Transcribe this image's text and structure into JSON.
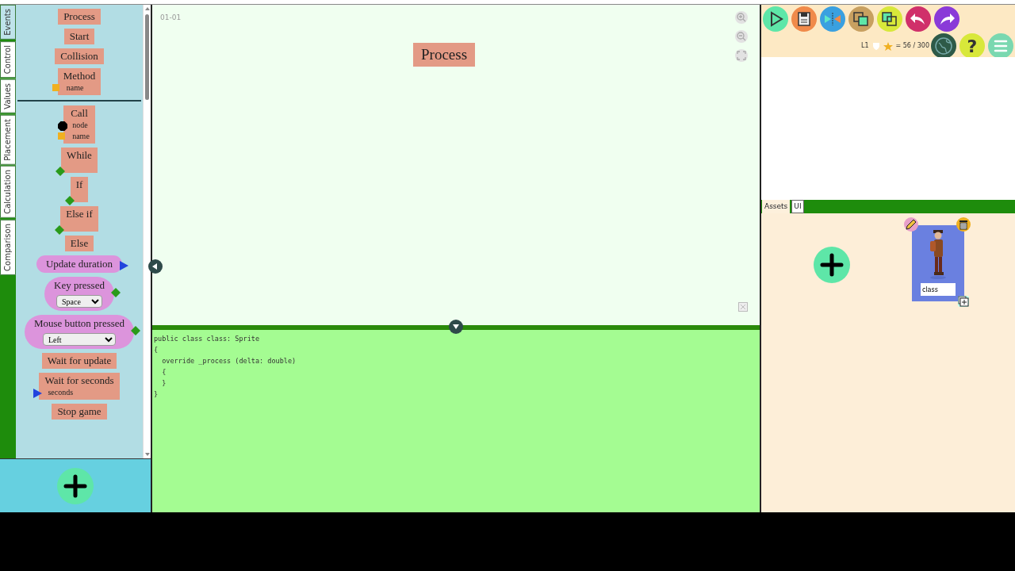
{
  "category_tabs": [
    {
      "label": "Events",
      "selected": true
    },
    {
      "label": "Control",
      "selected": false
    },
    {
      "label": "Values",
      "selected": false
    },
    {
      "label": "Placement",
      "selected": false
    },
    {
      "label": "Calculation",
      "selected": false
    },
    {
      "label": "Comparison",
      "selected": false
    }
  ],
  "palette": {
    "groups": [
      [
        {
          "label": "Process",
          "kind": "action"
        },
        {
          "label": "Start",
          "kind": "action"
        },
        {
          "label": "Collision",
          "kind": "action"
        },
        {
          "label": "Method",
          "kind": "action",
          "ports": [
            {
              "kind": "param",
              "label": "name"
            }
          ]
        }
      ],
      [
        {
          "label": "Call",
          "kind": "action",
          "ports": [
            {
              "kind": "node",
              "label": "node"
            },
            {
              "kind": "param",
              "label": "name"
            }
          ]
        },
        {
          "label": "While",
          "kind": "action",
          "ports": [
            {
              "kind": "condition"
            }
          ]
        },
        {
          "label": "If",
          "kind": "action",
          "ports": [
            {
              "kind": "condition"
            }
          ]
        },
        {
          "label": "Else if",
          "kind": "action",
          "ports": [
            {
              "kind": "condition"
            }
          ]
        },
        {
          "label": "Else",
          "kind": "action"
        },
        {
          "label": "Update duration",
          "kind": "trigger",
          "ports": [
            {
              "kind": "number"
            }
          ]
        },
        {
          "label": "Key pressed",
          "kind": "trigger",
          "ports": [
            {
              "kind": "condition"
            }
          ],
          "select": "Space"
        },
        {
          "label": "Mouse button pressed",
          "kind": "trigger",
          "ports": [
            {
              "kind": "condition"
            }
          ],
          "select": "Left"
        },
        {
          "label": "Wait for update",
          "kind": "action"
        },
        {
          "label": "Wait for seconds",
          "kind": "action",
          "ports": [
            {
              "kind": "number",
              "label": "seconds"
            }
          ]
        },
        {
          "label": "Stop game",
          "kind": "action"
        }
      ]
    ]
  },
  "canvas": {
    "scene_label": "01-01",
    "block": "Process"
  },
  "code": {
    "lines": [
      "public class class: Sprite",
      "{",
      "  override _process (delta: double)",
      "  {",
      "  }",
      "}"
    ]
  },
  "toolbar": {
    "level": "L1",
    "score": "= 56 / 300",
    "help": "?"
  },
  "assets": {
    "tabs": [
      {
        "label": "Assets",
        "selected": true
      },
      {
        "label": "UI",
        "selected": false
      }
    ],
    "items": [
      {
        "kind": "picture",
        "name": "class"
      }
    ]
  }
}
